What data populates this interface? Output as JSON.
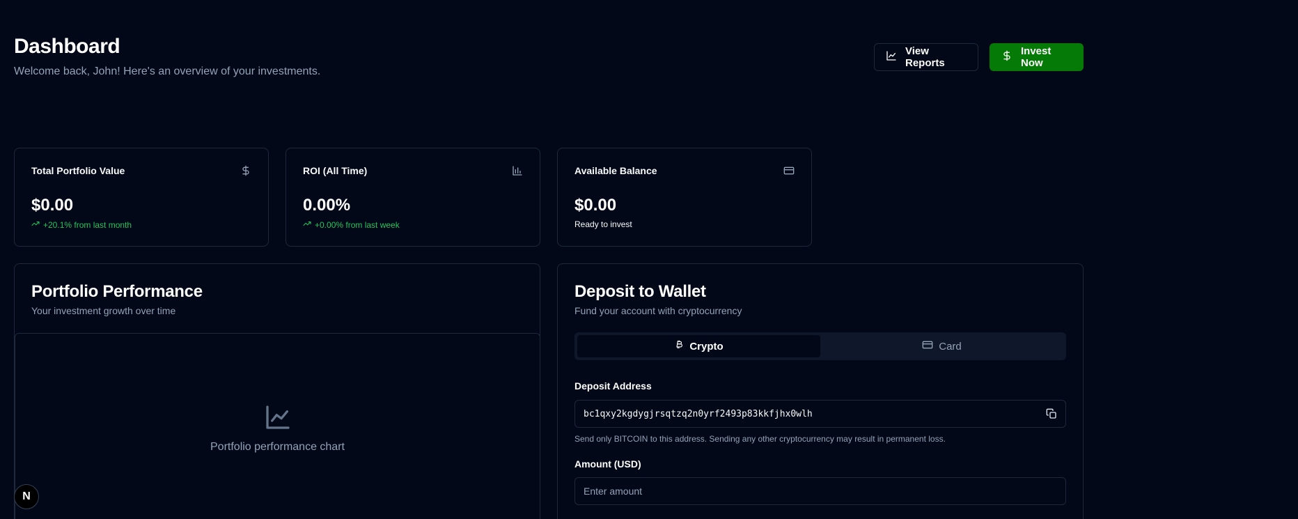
{
  "header": {
    "title": "Dashboard",
    "subtitle": "Welcome back, John! Here's an overview of your investments.",
    "view_reports_label": "View Reports",
    "invest_now_label": "Invest Now"
  },
  "stats": [
    {
      "label": "Total Portfolio Value",
      "value": "$0.00",
      "note": "+20.1% from last month",
      "icon": "dollar-icon"
    },
    {
      "label": "ROI (All Time)",
      "value": "0.00%",
      "note": "+0.00% from last week",
      "icon": "bar-chart-icon"
    },
    {
      "label": "Available Balance",
      "value": "$0.00",
      "note": "Ready to invest",
      "icon": "credit-card-icon"
    }
  ],
  "performance": {
    "title": "Portfolio Performance",
    "subtitle": "Your investment growth over time",
    "placeholder": "Portfolio performance chart"
  },
  "deposit": {
    "title": "Deposit to Wallet",
    "subtitle": "Fund your account with cryptocurrency",
    "tabs": [
      {
        "label": "Crypto",
        "active": true
      },
      {
        "label": "Card",
        "active": false
      }
    ],
    "address_label": "Deposit Address",
    "address": "bc1qxy2kgdygjrsqtzq2n0yrf2493p83kkfjhx0wlh",
    "warning": "Send only BITCOIN to this address. Sending any other cryptocurrency may result in permanent loss.",
    "amount_label": "Amount (USD)",
    "amount_placeholder": "Enter amount"
  },
  "badge": {
    "letter": "N"
  },
  "colors": {
    "background": "#020817",
    "accent_green": "#067a06",
    "positive": "#22c55e",
    "muted": "#94a3b8",
    "border": "#1e293b"
  }
}
